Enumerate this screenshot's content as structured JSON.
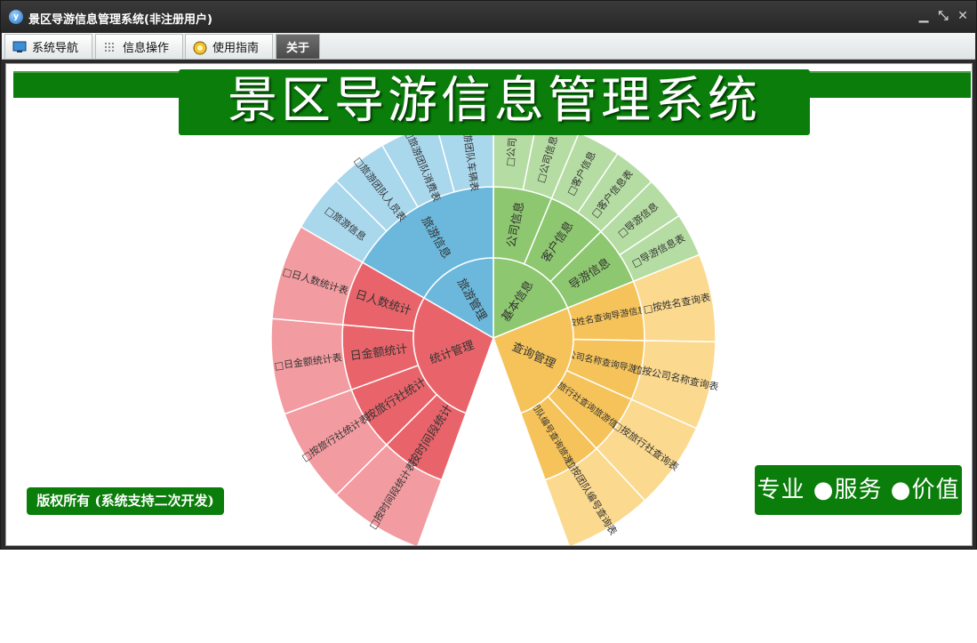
{
  "window": {
    "title": "景区导游信息管理系统(非注册用户)",
    "logo_text": "y",
    "controls": {
      "minimize": "▁",
      "restore": "⤡",
      "close": "✕"
    }
  },
  "toolbar": {
    "tabs": [
      {
        "label": "系统导航",
        "icon": "monitor-icon",
        "active": false
      },
      {
        "label": "信息操作",
        "icon": "grid-icon",
        "active": false
      },
      {
        "label": "使用指南",
        "icon": "guide-icon",
        "active": false
      },
      {
        "label": "关于",
        "icon": "",
        "active": true
      }
    ]
  },
  "main": {
    "heading": "景区导游信息管理系统",
    "copyright": "版权所有 (系统支持二次开发)",
    "slogan": "专业 ●服务 ●价值"
  },
  "sunburst": {
    "title": "",
    "groups": [
      {
        "name": "基本信息",
        "color": "#8dc76f",
        "children": [
          {
            "name": "公司信息",
            "leaves": [
              "公司",
              "公司信息"
            ]
          },
          {
            "name": "客户信息",
            "leaves": [
              "客户信息",
              "客户信息表"
            ]
          },
          {
            "name": "导游信息",
            "leaves": [
              "导游信息",
              "导游信息表"
            ]
          }
        ]
      },
      {
        "name": "查询管理",
        "color": "#f5c35a",
        "children": [
          {
            "name": "按姓名查询导游信息",
            "leaves": [
              "按姓名查询表"
            ]
          },
          {
            "name": "按公司名称查询导游信息",
            "leaves": [
              "按公司名称查询表"
            ]
          },
          {
            "name": "按旅行社查询旅游信息",
            "leaves": [
              "按旅行社查询表"
            ]
          },
          {
            "name": "按团队编号查询旅游信息",
            "leaves": [
              "按团队编号查询表"
            ]
          }
        ]
      },
      {
        "name": "统计管理",
        "color": "#e9646a",
        "children": [
          {
            "name": "按时间段统计",
            "leaves": [
              "按时间段统计表"
            ]
          },
          {
            "name": "按旅行社统计",
            "leaves": [
              "按旅行社统计表"
            ]
          },
          {
            "name": "日金额统计",
            "leaves": [
              "日金额统计表"
            ]
          },
          {
            "name": "日人数统计",
            "leaves": [
              "日人数统计表"
            ]
          }
        ]
      },
      {
        "name": "旅游管理",
        "color": "#6bb8dc",
        "children": [
          {
            "name": "旅游信息",
            "leaves": [
              "旅游信息",
              "旅游团队人员表",
              "旅游团队消费表",
              "旅游团队车辆表"
            ]
          }
        ]
      }
    ]
  }
}
